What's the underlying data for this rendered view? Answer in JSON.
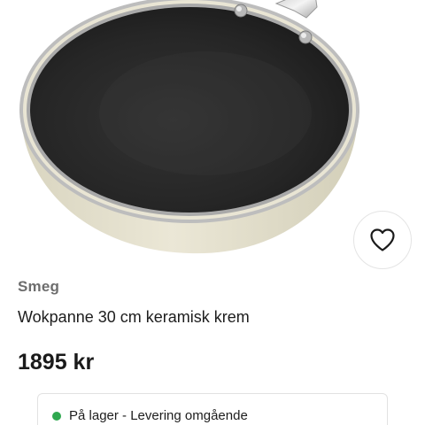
{
  "product": {
    "image_alt": "wok-pan",
    "brand": "Smeg",
    "name": "Wokpanne 30 cm keramisk krem",
    "price": "1895 kr"
  },
  "favorite": {
    "icon": "heart-outline-icon"
  },
  "stock": {
    "status_text": "På lager - Levering omgående",
    "status_color": "#2fa84f"
  },
  "colors": {
    "pan_exterior": "#e8e4d2",
    "pan_interior": "#262626",
    "text_primary": "#1d1d1d",
    "brand_text": "#6d6d6d"
  }
}
